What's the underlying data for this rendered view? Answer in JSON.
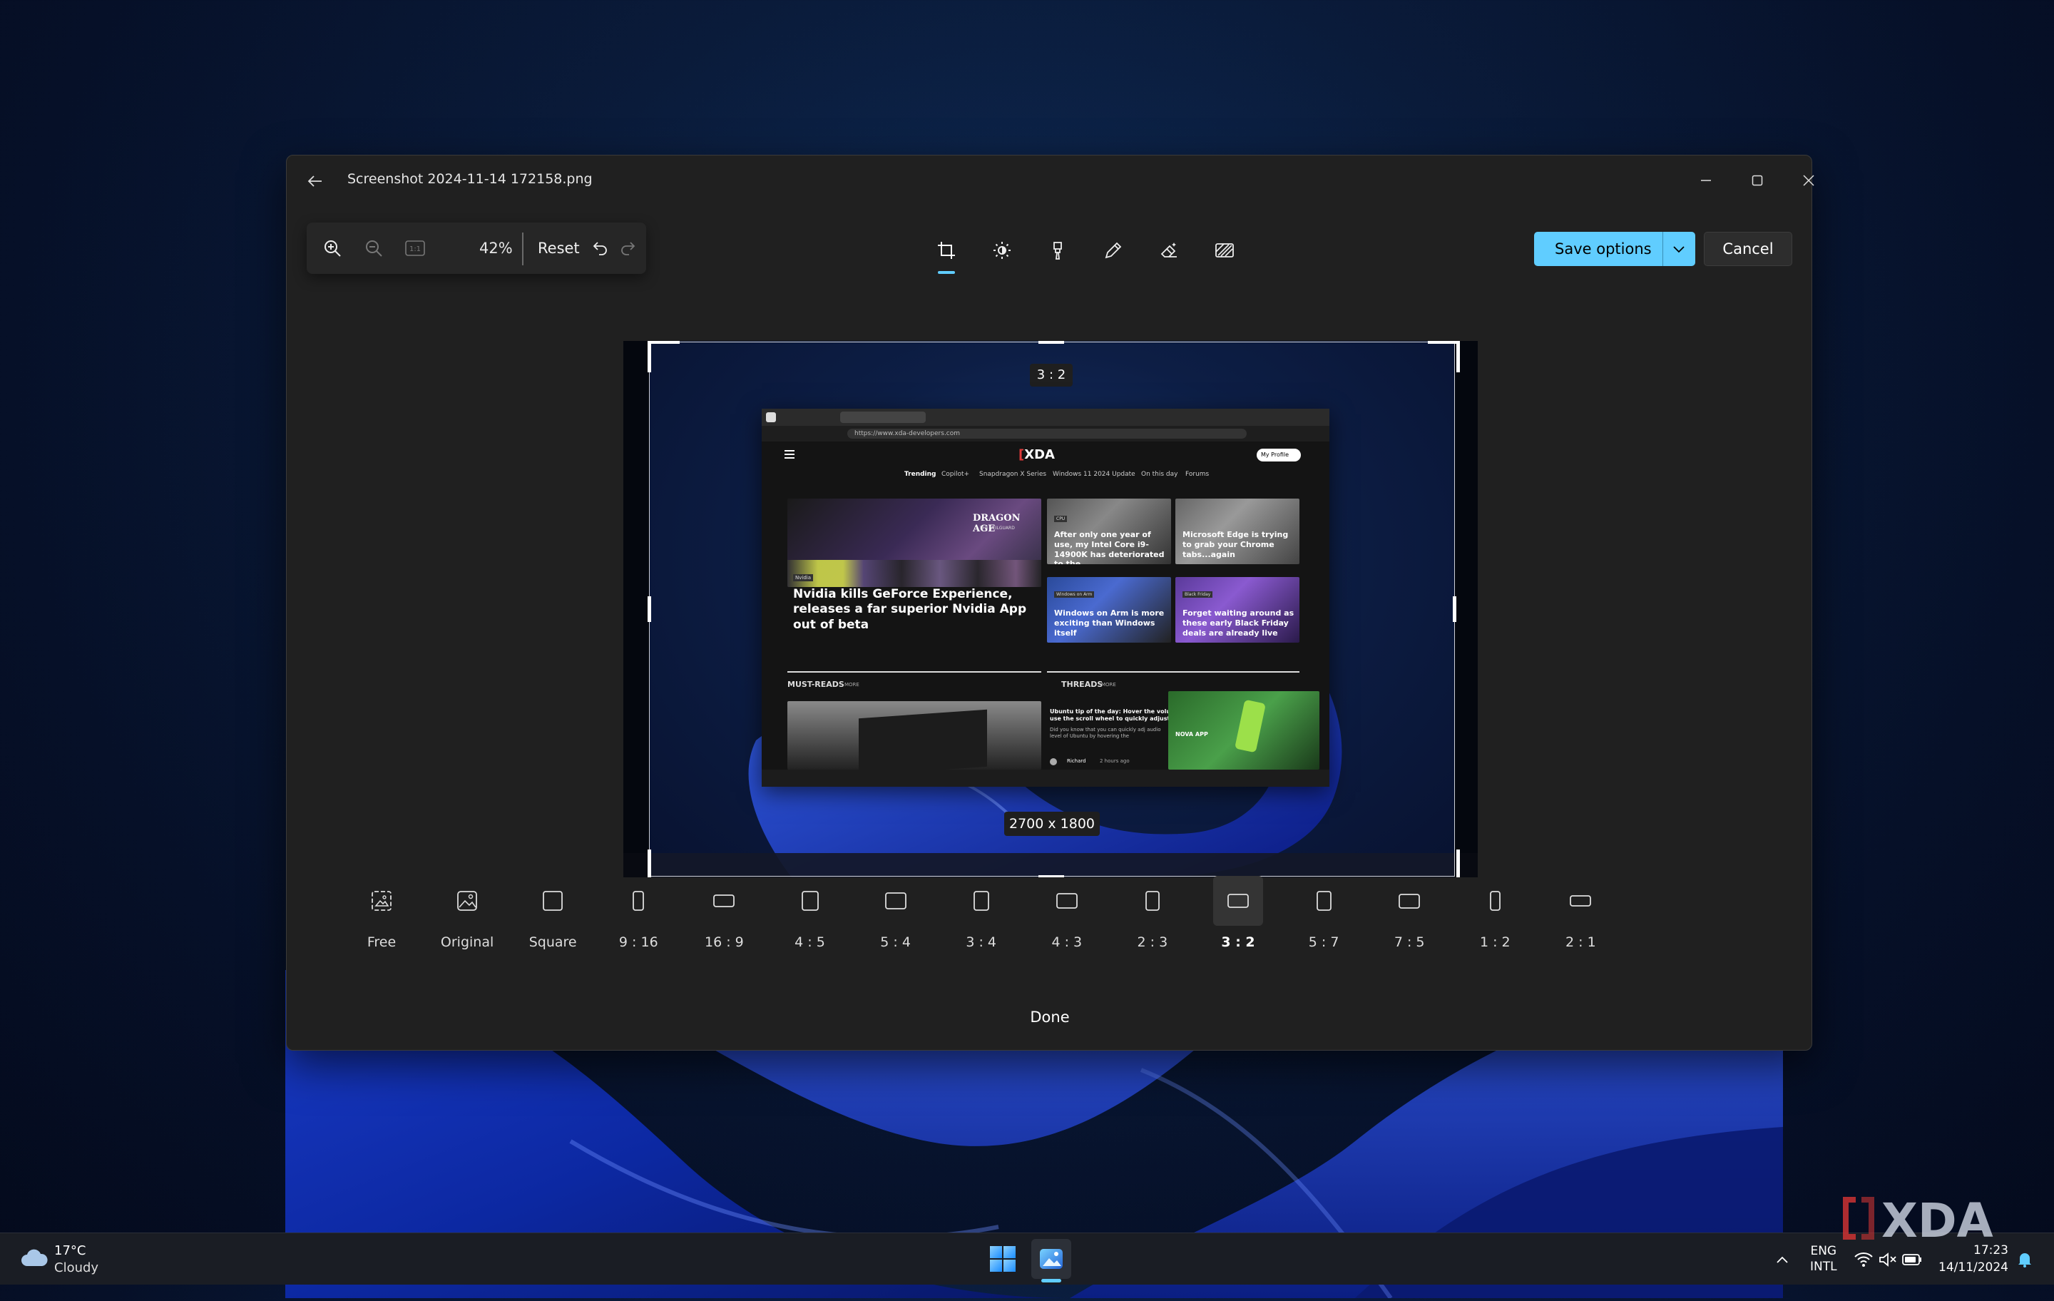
{
  "window": {
    "title": "Screenshot 2024-11-14 172158.png"
  },
  "toolbar": {
    "zoom_value": "42%",
    "reset_label": "Reset",
    "actual_size_glyph": "1:1",
    "icons": [
      "zoom-in-icon",
      "zoom-out-icon",
      "actual-size-icon",
      "undo-icon",
      "redo-icon"
    ],
    "tools": [
      "crop-icon",
      "adjust-icon",
      "filter-icon",
      "markup-icon",
      "erase-icon",
      "background-blur-icon"
    ],
    "active_tool": "crop"
  },
  "actions": {
    "save_label": "Save options",
    "cancel_label": "Cancel",
    "accent_color": "#60cdff"
  },
  "crop": {
    "ratio_badge": "3 : 2",
    "size_badge": "2700 x 1800"
  },
  "inner_page": {
    "logo_bracket": "[",
    "logo": "XDA",
    "url": "https://www.xda-developers.com",
    "profile_label": "My Profile",
    "trending": [
      "Trending",
      "Copilot+",
      "Snapdragon X Series",
      "Windows 11 2024 Update",
      "On this day",
      "Forums"
    ],
    "hero_tag": "Nvidia",
    "hero_headline": "Nvidia kills GeForce Experience, releases a far superior Nvidia App out of beta",
    "cards": [
      {
        "tag": "CPU",
        "headline": "After only one year of use, my Intel Core i9-14900K has deteriorated to the..."
      },
      {
        "tag": "",
        "headline": "Microsoft Edge is trying to grab your Chrome tabs...again"
      },
      {
        "tag": "Windows on Arm",
        "headline": "Windows on Arm is more exciting than Windows itself"
      },
      {
        "tag": "Black Friday",
        "headline": "Forget waiting around as these early Black Friday deals are already live"
      }
    ],
    "must_reads": "MUST-READS",
    "threads": "THREADS",
    "more": "MORE",
    "thread_title": "Ubuntu tip of the day: Hover the volu use the scroll wheel to quickly adjust",
    "thread_body": "Did you know that you can quickly adj audio level of Ubuntu by hovering the",
    "thread_author": "Richard",
    "thread_time": "2 hours ago",
    "ad_label": "NOVA APP",
    "game_title": "DRAGON AGE",
    "game_subtitle": "THE VEILGUARD"
  },
  "ratios": [
    {
      "label": "Free",
      "icon": "free-crop-icon"
    },
    {
      "label": "Original",
      "icon": "original-image-icon"
    },
    {
      "label": "Square",
      "icon": "square-icon"
    },
    {
      "label": "9 : 16",
      "icon": "portrait-9-16-icon"
    },
    {
      "label": "16 : 9",
      "icon": "landscape-16-9-icon"
    },
    {
      "label": "4 : 5",
      "icon": "portrait-4-5-icon"
    },
    {
      "label": "5 : 4",
      "icon": "landscape-5-4-icon"
    },
    {
      "label": "3 : 4",
      "icon": "portrait-3-4-icon"
    },
    {
      "label": "4 : 3",
      "icon": "landscape-4-3-icon"
    },
    {
      "label": "2 : 3",
      "icon": "portrait-2-3-icon"
    },
    {
      "label": "3 : 2",
      "icon": "landscape-3-2-icon",
      "selected": true
    },
    {
      "label": "5 : 7",
      "icon": "portrait-5-7-icon"
    },
    {
      "label": "7 : 5",
      "icon": "landscape-7-5-icon"
    },
    {
      "label": "1 : 2",
      "icon": "portrait-1-2-icon"
    },
    {
      "label": "2 : 1",
      "icon": "landscape-2-1-icon"
    }
  ],
  "done_label": "Done",
  "taskbar": {
    "weather_temp": "17°C",
    "weather_condition": "Cloudy",
    "lang_line1": "ENG",
    "lang_line2": "INTL",
    "time": "17:23",
    "date": "14/11/2024",
    "tray_icons": [
      "wifi-icon",
      "speaker-muted-icon",
      "battery-icon"
    ]
  },
  "watermark": "XDA"
}
